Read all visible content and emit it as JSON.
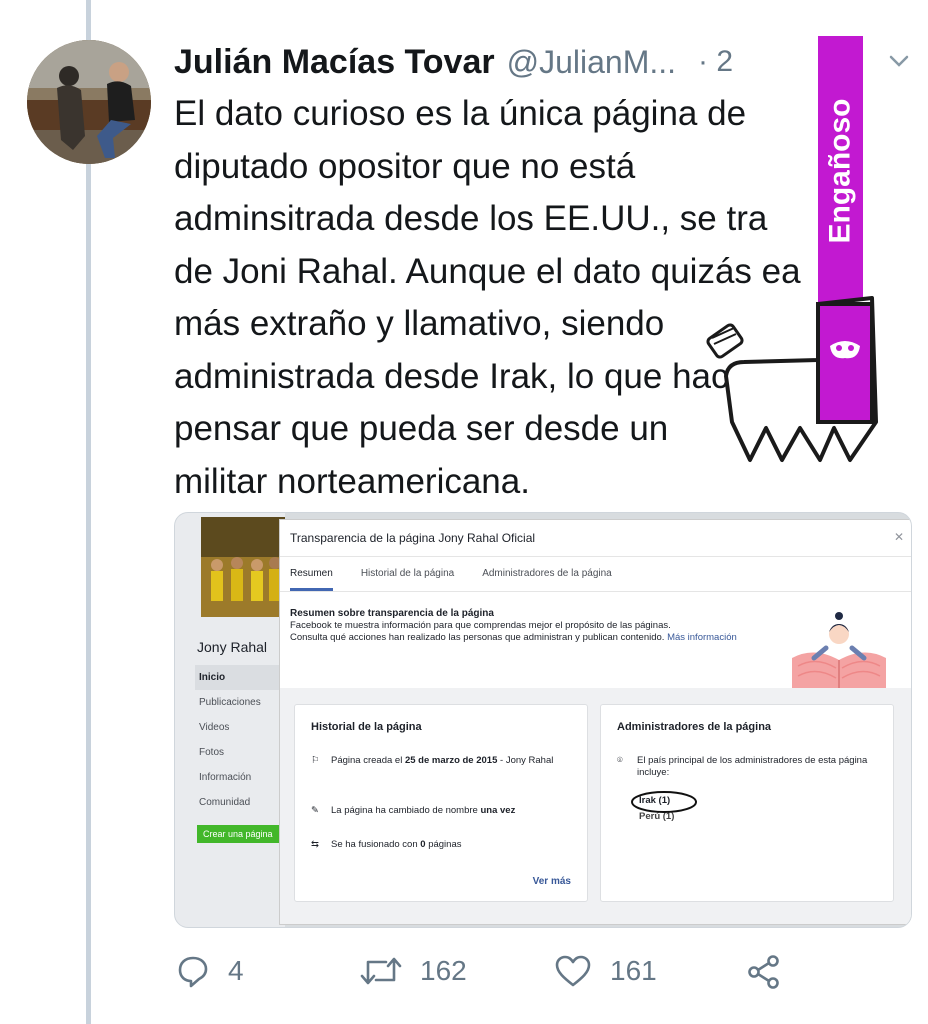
{
  "tweet": {
    "author_name": "Julián Macías Tovar",
    "handle": "@JulianM...",
    "time": "· 2",
    "lines": [
      "El dato curioso es la única página de",
      "diputado opositor que no está",
      "adminsitrada desde los EE.UU., se tra",
      "de Joni Rahal. Aunque el dato quizás ea",
      "más extraño y llamativo, siendo",
      "administrada desde Irak, lo que hace",
      "pensar que pueda ser desde un",
      "militar norteamericana."
    ],
    "actions": {
      "replies": "4",
      "retweets": "162",
      "likes": "161"
    }
  },
  "label": {
    "text": "Engañoso",
    "color": "#c219d1"
  },
  "embedded": {
    "page_name": "Jony Rahal",
    "nav": [
      "Inicio",
      "Publicaciones",
      "Videos",
      "Fotos",
      "Información",
      "Comunidad"
    ],
    "create_button": "Crear una página",
    "modal_title": "Transparencia de la página Jony Rahal Oficial",
    "tabs": [
      "Resumen",
      "Historial de la página",
      "Administradores de la página"
    ],
    "summary_title": "Resumen sobre transparencia de la página",
    "summary_text_1": "Facebook te muestra información para que comprendas mejor el propósito de las páginas.",
    "summary_text_2": "Consulta qué acciones han realizado las personas que administran y publican contenido.",
    "summary_more": "Más información",
    "history": {
      "title": "Historial de la página",
      "created_prefix": "Página creada el",
      "created_date": "25 de marzo de 2015",
      "created_suffix": "- Jony Rahal",
      "name_change_prefix": "La página ha cambiado de nombre",
      "name_change_count": "una vez",
      "merged_prefix": "Se ha fusionado con",
      "merged_count": "0",
      "merged_suffix": "páginas",
      "see_more": "Ver más"
    },
    "admins": {
      "title": "Administradores de la página",
      "text": "El país principal de los administradores de esta página incluye:",
      "countries": [
        "Irak (1)",
        "Perú (1)"
      ]
    }
  }
}
